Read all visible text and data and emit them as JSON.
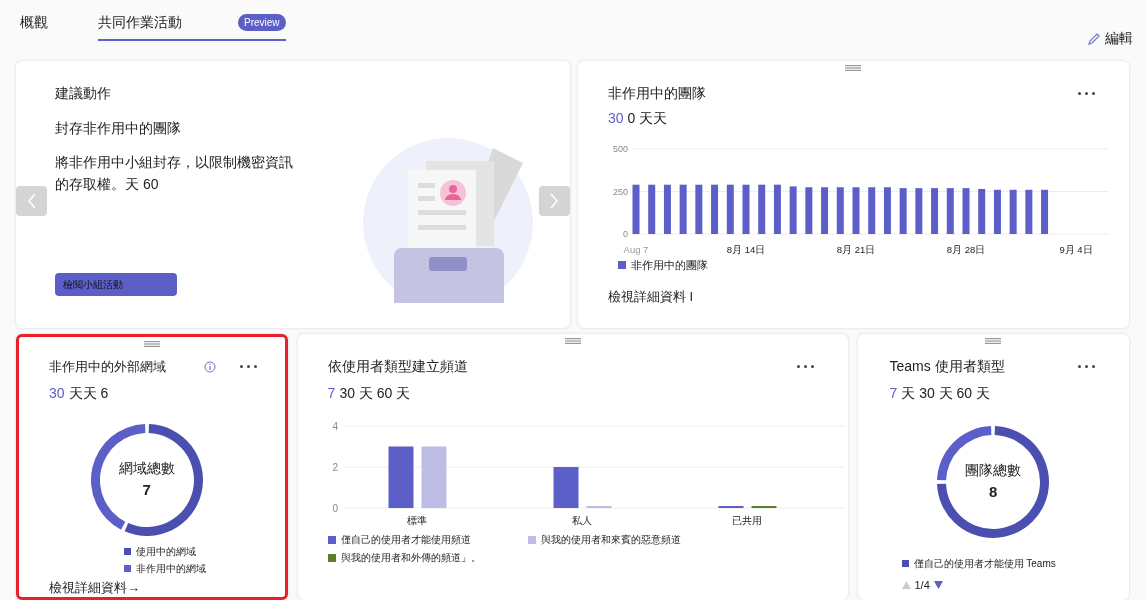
{
  "tabs": [
    {
      "label": "概觀",
      "selected": false
    },
    {
      "label": "共同作業活動",
      "selected": true,
      "badge": "Preview"
    }
  ],
  "edit_button": {
    "label": "編輯"
  },
  "suggestion_card": {
    "heading": "建議動作",
    "title": "封存非作用中的團隊",
    "description": "將非作用中小組封存，以限制機密資訊的存取權。天 60",
    "button": "檢閱小組活動"
  },
  "inactive_teams_card": {
    "title": "非作用中的團隊",
    "period": {
      "highlight": "30",
      "rest": "0 天天"
    },
    "link": "檢視詳細資料 I",
    "chart_data": {
      "type": "bar",
      "categories": [
        "Aug 7",
        null,
        null,
        null,
        null,
        null,
        null,
        "8月 14日",
        null,
        null,
        null,
        null,
        null,
        null,
        "8月 21日",
        null,
        null,
        null,
        null,
        null,
        null,
        "8月 28日",
        null,
        null,
        null,
        null,
        null,
        null,
        "9月 4日"
      ],
      "series": [
        {
          "name": "非作用中的團隊",
          "color": "#5b5fc7",
          "values": [
            290,
            290,
            290,
            290,
            290,
            290,
            290,
            290,
            290,
            290,
            280,
            275,
            275,
            275,
            275,
            275,
            275,
            270,
            270,
            270,
            270,
            270,
            265,
            260,
            260,
            260,
            260,
            null,
            null
          ]
        }
      ],
      "ylim": [
        0,
        500
      ],
      "yticks": [
        0,
        250,
        500
      ]
    }
  },
  "external_domains_card": {
    "highlighted": true,
    "title": "非作用中的外部網域",
    "period": {
      "highlight": "30",
      "rest": "天天 6"
    },
    "center_label": "網域總數",
    "center_value": "7",
    "link": "檢視詳細資料→",
    "chart_data": {
      "type": "donut",
      "categories": [
        "使用中的網域",
        "非作用中的網域"
      ],
      "values": [
        57.1,
        42.9
      ],
      "colors": [
        "#4a4fb0",
        "#5b5fc7"
      ]
    }
  },
  "channels_card": {
    "title": "依使用者類型建立頻道",
    "period": {
      "highlight": "7",
      "rest": "30 天 60 天"
    },
    "chart_data": {
      "type": "bar",
      "categories": [
        "標準",
        "私人",
        "已共用"
      ],
      "ylim": [
        0,
        4
      ],
      "yticks": [
        0,
        2,
        4
      ],
      "series": [
        {
          "name": "僅自己的使用者才能使用頻道",
          "color": "#5b5fc7",
          "values": [
            3,
            2,
            0
          ]
        },
        {
          "name": "與我的使用者和來賓的惡意頻道",
          "color": "#bcbce4",
          "values": [
            3,
            0,
            null
          ]
        },
        {
          "name": "與我的使用者和外傳的頻道」。",
          "color": "#5a7f2b",
          "values": [
            null,
            null,
            0
          ]
        }
      ]
    }
  },
  "teams_user_types_card": {
    "title": "Teams 使用者類型",
    "period": {
      "highlight": "7",
      "rest": "天 30 天 60 天"
    },
    "center_label": "團隊總數",
    "center_value": "8",
    "legend_page": "1/4",
    "chart_data": {
      "type": "donut",
      "categories": [
        "僅自己的使用者才能使用 Teams",
        null
      ],
      "values": [
        75,
        25
      ],
      "colors": [
        "#4a4fb0",
        "#5b5fc7"
      ]
    }
  }
}
